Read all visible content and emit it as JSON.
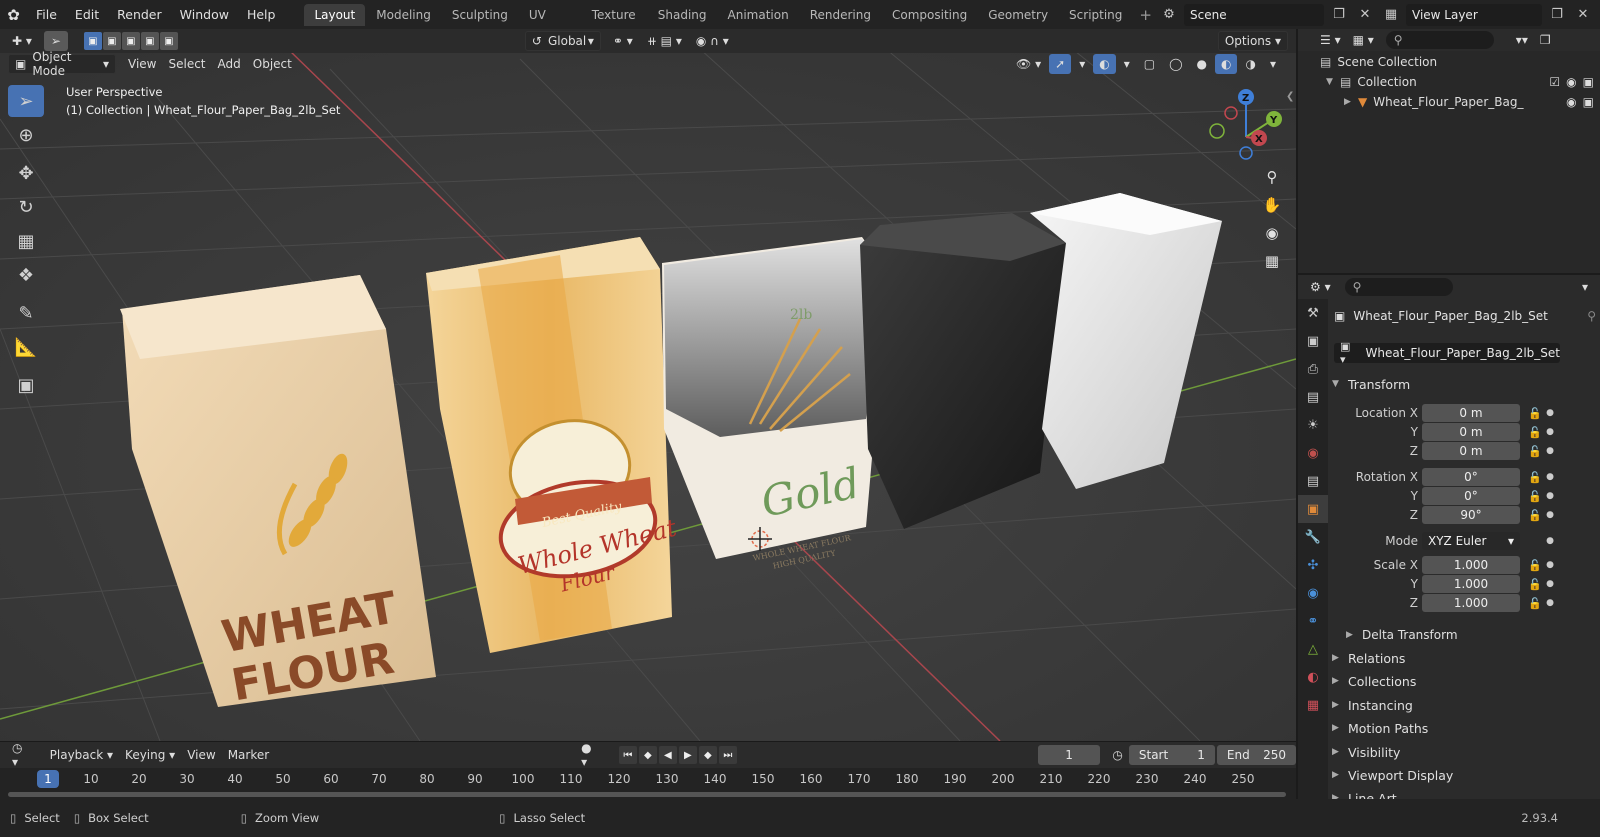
{
  "menu": [
    "File",
    "Edit",
    "Render",
    "Window",
    "Help"
  ],
  "workspaces": [
    "Layout",
    "Modeling",
    "Sculpting",
    "UV Editing",
    "Texture Paint",
    "Shading",
    "Animation",
    "Rendering",
    "Compositing",
    "Geometry Nodes",
    "Scripting"
  ],
  "active_workspace": "Layout",
  "scene_name": "Scene",
  "view_layer": "View Layer",
  "header": {
    "transform_orientation": "Global",
    "options_label": "Options",
    "mode": "Object Mode",
    "menus": [
      "View",
      "Select",
      "Add",
      "Object"
    ]
  },
  "viewport": {
    "perspective": "User Perspective",
    "collection_line": "(1) Collection | Wheat_Flour_Paper_Bag_2lb_Set",
    "gizmo_axes": {
      "x": "X",
      "y": "Y",
      "z": "Z"
    },
    "bag1_line1": "WHEAT",
    "bag1_line2": "FLOUR",
    "bag2_label1": "Best Quality",
    "bag2_label2": "Whole Wheat",
    "bag2_label3": "Flour",
    "bag3_weight": "2lb",
    "bag3_brand": "Gold",
    "bag3_sub1": "WHOLE WHEAT FLOUR",
    "bag3_sub2": "HIGH QUALITY"
  },
  "timeline": {
    "menus": [
      "Playback",
      "Keying",
      "View",
      "Marker"
    ],
    "current_frame": "1",
    "start_label": "Start",
    "start": "1",
    "end_label": "End",
    "end": "250",
    "ruler": [
      "1",
      "10",
      "20",
      "30",
      "40",
      "50",
      "60",
      "70",
      "80",
      "90",
      "100",
      "110",
      "120",
      "130",
      "140",
      "150",
      "160",
      "170",
      "180",
      "190",
      "200",
      "210",
      "220",
      "230",
      "240",
      "250"
    ]
  },
  "statusbar": {
    "select": "Select",
    "box_select": "Box Select",
    "zoom_view": "Zoom View",
    "lasso_select": "Lasso Select",
    "version": "2.93.4"
  },
  "outliner": {
    "scene_collection": "Scene Collection",
    "collection": "Collection",
    "object": "Wheat_Flour_Paper_Bag_"
  },
  "properties": {
    "object_name": "Wheat_Flour_Paper_Bag_2lb_Set",
    "object_field": "Wheat_Flour_Paper_Bag_2lb_Set",
    "transform_title": "Transform",
    "location_label": "Location X",
    "location": [
      "0 m",
      "0 m",
      "0 m"
    ],
    "rotation_label": "Rotation X",
    "rotation": [
      "0°",
      "0°",
      "90°"
    ],
    "mode_label": "Mode",
    "mode_value": "XYZ Euler",
    "scale_label": "Scale X",
    "scale": [
      "1.000",
      "1.000",
      "1.000"
    ],
    "axis_y": "Y",
    "axis_z": "Z",
    "delta_transform": "Delta Transform",
    "panels": [
      "Relations",
      "Collections",
      "Instancing",
      "Motion Paths",
      "Visibility",
      "Viewport Display",
      "Line Art"
    ]
  },
  "colors": {
    "accent": "#4772b3",
    "x_axis": "#c2474f",
    "y_axis": "#7fb43b",
    "z_axis": "#3f7fd8"
  },
  "icons": [
    "blender-logo",
    "cursor-icon",
    "move-icon",
    "rotate-icon",
    "scale-icon",
    "transform-icon",
    "annotate-icon",
    "measure-icon",
    "add-cube-icon",
    "zoom-icon",
    "hand-icon",
    "camera-icon",
    "grid-icon",
    "eye-icon",
    "camera-render-icon",
    "funnel-icon",
    "pin-icon",
    "lock-icon"
  ]
}
